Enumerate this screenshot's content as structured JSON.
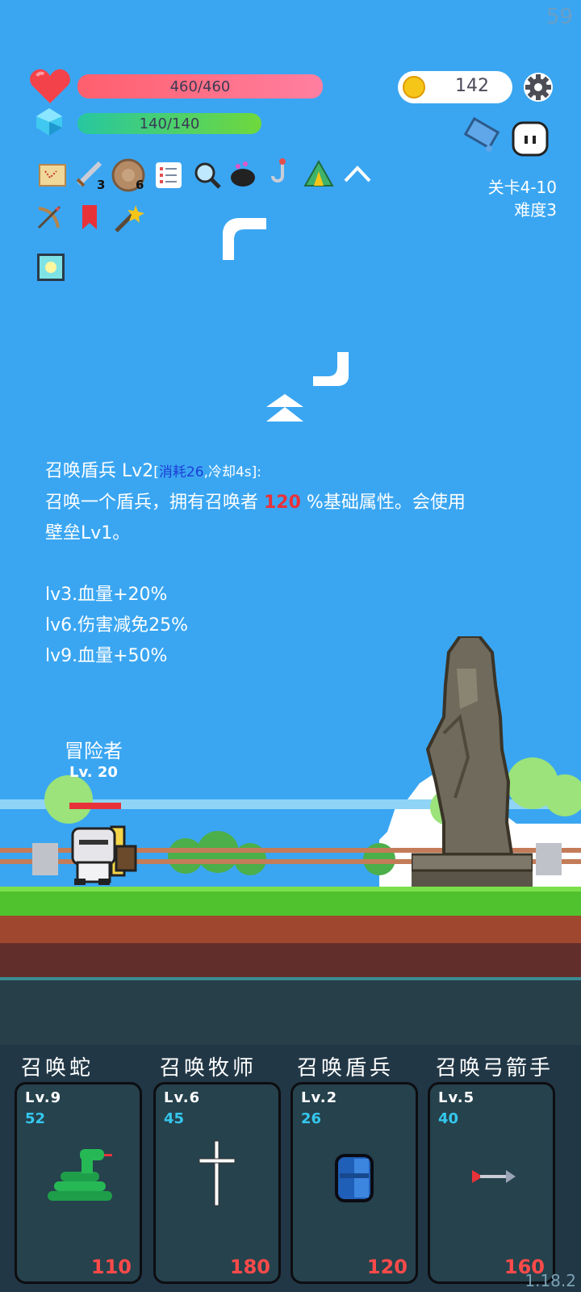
{
  "fps": "59",
  "hud": {
    "hp_text": "460/460",
    "hp_fraction": 1.0,
    "mp_text": "140/140",
    "mp_fraction": 1.0,
    "coins": "142",
    "stage": "关卡4-10",
    "difficulty": "难度3"
  },
  "items": [
    {
      "icon": "map-icon",
      "badge": ""
    },
    {
      "icon": "sword-icon",
      "badge": "3"
    },
    {
      "icon": "shield-icon",
      "badge": "6"
    },
    {
      "icon": "list-icon",
      "badge": ""
    },
    {
      "icon": "magnifier-icon",
      "badge": ""
    },
    {
      "icon": "cauldron-icon",
      "badge": ""
    },
    {
      "icon": "hook-icon",
      "badge": ""
    },
    {
      "icon": "tent-icon",
      "badge": ""
    },
    {
      "icon": "collapse-icon",
      "badge": ""
    },
    {
      "icon": "crossbow-icon",
      "badge": ""
    },
    {
      "icon": "bookmark-icon",
      "badge": ""
    },
    {
      "icon": "magic-wand-icon",
      "badge": ""
    },
    {
      "icon": "lamp-icon",
      "badge": ""
    }
  ],
  "skill": {
    "name": "召唤盾兵 Lv2",
    "bracket_open": "[",
    "cost_cd": "消耗26",
    "cd": ",冷却4s",
    "bracket_close": "]:",
    "line1_pre": "召唤一个盾兵，拥有召唤者 ",
    "line1_value": "120",
    "line1_post": " %基础属性。会使用",
    "line2": "壁垒Lv1。",
    "perks": [
      "lv3.血量+20%",
      "lv6.伤害减免25%",
      "lv9.血量+50%"
    ]
  },
  "player": {
    "name": "冒险者",
    "level": "Lv. 20"
  },
  "cards": [
    {
      "title": "召唤蛇",
      "level": "Lv.9",
      "cost": "52",
      "price": "110",
      "icon": "snake-icon"
    },
    {
      "title": "召唤牧师",
      "level": "Lv.6",
      "cost": "45",
      "price": "180",
      "icon": "cross-icon"
    },
    {
      "title": "召唤盾兵",
      "level": "Lv.2",
      "cost": "26",
      "price": "120",
      "icon": "blue-shield-icon"
    },
    {
      "title": "召唤弓箭手",
      "level": "Lv.5",
      "cost": "40",
      "price": "160",
      "icon": "arrow-icon"
    }
  ],
  "version": "1.18.2",
  "colors": {
    "sky": "#3aa6f2",
    "hp": "#ff6b82",
    "mp": "#4fcf6a",
    "price": "#ff4a4a",
    "cost": "#35c7ee"
  }
}
